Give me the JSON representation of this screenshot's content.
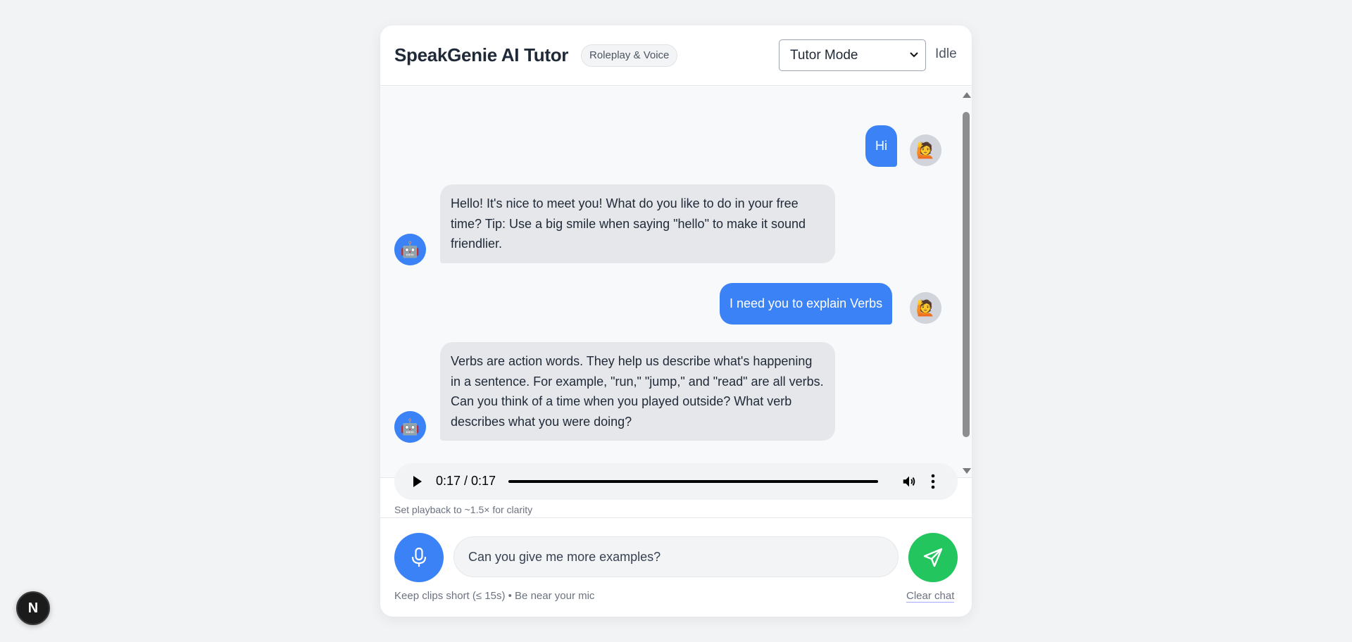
{
  "header": {
    "title": "SpeakGenie AI Tutor",
    "badge": "Roleplay & Voice",
    "mode_select": {
      "selected": "Tutor Mode"
    },
    "status": "Idle"
  },
  "messages": [
    {
      "role": "user",
      "text": "Hi",
      "avatar": "🙋"
    },
    {
      "role": "bot",
      "text": "Hello! It's nice to meet you! What do you like to do in your free time? Tip: Use a big smile when saying \"hello\" to make it sound friendlier.",
      "avatar": "🤖"
    },
    {
      "role": "user",
      "text": "I need you to explain Verbs",
      "avatar": "🙋"
    },
    {
      "role": "bot",
      "text": "Verbs are action words. They help us describe what's happening in a sentence. For example, \"run,\" \"jump,\" and \"read\" are all verbs. Can you think of a time when you played outside? What verb describes what you were doing?",
      "avatar": "🤖"
    }
  ],
  "audio_player": {
    "time": "0:17 / 0:17",
    "progress_fraction": 1.0
  },
  "playback_hint": "Set playback to ~1.5× for clarity",
  "composer": {
    "input_value": "Can you give me more examples?"
  },
  "footer": {
    "note": "Keep clips short (≤ 15s) • Be near your mic",
    "clear_label": "Clear chat"
  },
  "dev_badge": {
    "label": "N"
  },
  "colors": {
    "accent": "#3b82f6",
    "send": "#22c55e",
    "bot_bubble": "#e5e7eb"
  }
}
